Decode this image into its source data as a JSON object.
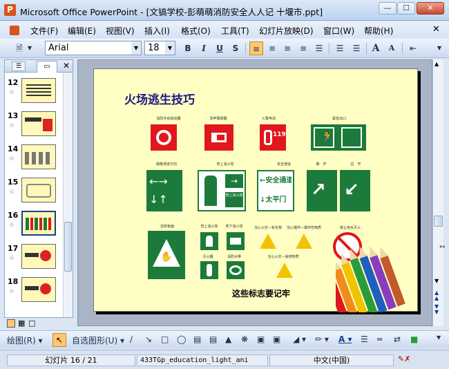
{
  "window": {
    "title": "Microsoft Office PowerPoint - [文镐学校-彭萌萌消防安全人人记 十堰市.ppt]",
    "app_icon": "powerpoint-icon"
  },
  "menu": [
    {
      "label": "文件(F)"
    },
    {
      "label": "编辑(E)"
    },
    {
      "label": "视图(V)"
    },
    {
      "label": "插入(I)"
    },
    {
      "label": "格式(O)"
    },
    {
      "label": "工具(T)"
    },
    {
      "label": "幻灯片放映(D)"
    },
    {
      "label": "窗口(W)"
    },
    {
      "label": "帮助(H)"
    }
  ],
  "toolbar": {
    "font_name": "Arial",
    "font_size": "18",
    "bold": "B",
    "italic": "I",
    "underline": "U",
    "shadow": "S",
    "grow_font": "A",
    "shrink_font": "A"
  },
  "slides_pane": {
    "slides": [
      {
        "number": "12"
      },
      {
        "number": "13"
      },
      {
        "number": "14"
      },
      {
        "number": "15"
      },
      {
        "number": "16"
      },
      {
        "number": "17"
      },
      {
        "number": "18"
      }
    ],
    "current": "16"
  },
  "slide": {
    "title": "火场逃生技巧",
    "footer": "这些标志要记牢",
    "signs_row1": [
      {
        "label": "消防手动启动器"
      },
      {
        "label": "发声警报器"
      },
      {
        "label": "火警电话"
      },
      {
        "label": "紧急出口"
      }
    ],
    "phone_number": "119",
    "signs_row2": [
      {
        "label": "疏散通道方向"
      },
      {
        "label": "地上消火栓"
      },
      {
        "label": "安全通道"
      },
      {
        "label": "推　开"
      },
      {
        "label": "拉　开"
      }
    ],
    "safe_passage_text": "安全通道",
    "exit_door_text": "太平门",
    "hydrant_text": "地上消火栓",
    "signs_row3": [
      {
        "label": "击碎板面"
      },
      {
        "label": "地上消火栓"
      },
      {
        "label": "地下消火栓"
      },
      {
        "label": "当心火灾—氧化物"
      },
      {
        "label": "当心爆炸—爆炸性物质"
      },
      {
        "label": "禁止用水灭火"
      },
      {
        "label": "灭火器"
      },
      {
        "label": "消防水带"
      },
      {
        "label": "当心火灾—易燃物质"
      }
    ]
  },
  "drawbar": {
    "draw_label": "绘图(R)",
    "autoshape_label": "自选图形(U)"
  },
  "status": {
    "slide_info": "幻灯片 16 / 21",
    "design": "433TGp_education_light_ani",
    "language": "中文(中国)"
  }
}
